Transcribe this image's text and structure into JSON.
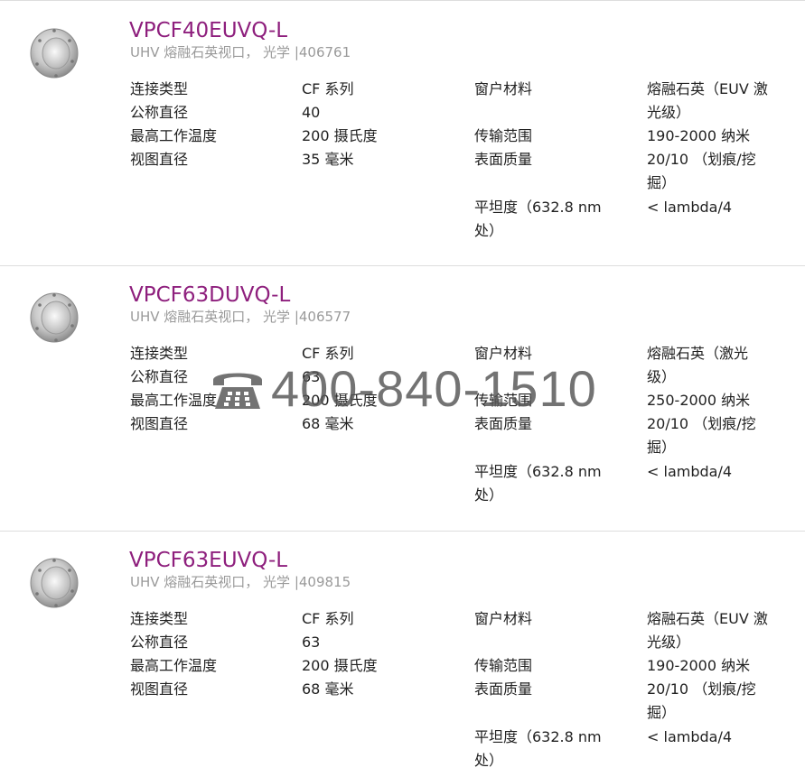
{
  "products": [
    {
      "title": "VPCF40EUVQ-L",
      "subtitle": "UHV 熔融石英视口， 光学 |406761",
      "specs": {
        "connection_type_label": "连接类型",
        "connection_type_value": "CF 系列",
        "nominal_diameter_label": "公称直径",
        "nominal_diameter_value": "40",
        "max_temp_label": "最高工作温度",
        "max_temp_value": "200 摄氏度",
        "view_diameter_label": "视图直径",
        "view_diameter_value": "35 毫米",
        "window_material_label": "窗户材料",
        "window_material_value_1": "熔融石英（EUV 激",
        "window_material_value_2": "光级）",
        "transmission_range_label": "传输范围",
        "transmission_range_value": "190-2000 纳米",
        "surface_quality_label": "表面质量",
        "surface_quality_value_1": "20/10 （划痕/挖",
        "surface_quality_value_2": "掘）",
        "flatness_label_1": "平坦度（632.8 nm",
        "flatness_label_2": "处）",
        "flatness_value": "< lambda/4"
      }
    },
    {
      "title": "VPCF63DUVQ-L",
      "subtitle": "UHV 熔融石英视口， 光学 |406577",
      "specs": {
        "connection_type_label": "连接类型",
        "connection_type_value": "CF 系列",
        "nominal_diameter_label": "公称直径",
        "nominal_diameter_value": "63",
        "max_temp_label": "最高工作温度",
        "max_temp_value": "200 摄氏度",
        "view_diameter_label": "视图直径",
        "view_diameter_value": "68 毫米",
        "window_material_label": "窗户材料",
        "window_material_value_1": "熔融石英（激光",
        "window_material_value_2": "级）",
        "transmission_range_label": "传输范围",
        "transmission_range_value": "250-2000 纳米",
        "surface_quality_label": "表面质量",
        "surface_quality_value_1": "20/10 （划痕/挖",
        "surface_quality_value_2": "掘）",
        "flatness_label_1": "平坦度（632.8 nm",
        "flatness_label_2": "处）",
        "flatness_value": "< lambda/4"
      }
    },
    {
      "title": "VPCF63EUVQ-L",
      "subtitle": "UHV 熔融石英视口， 光学 |409815",
      "specs": {
        "connection_type_label": "连接类型",
        "connection_type_value": "CF 系列",
        "nominal_diameter_label": "公称直径",
        "nominal_diameter_value": "63",
        "max_temp_label": "最高工作温度",
        "max_temp_value": "200 摄氏度",
        "view_diameter_label": "视图直径",
        "view_diameter_value": "68 毫米",
        "window_material_label": "窗户材料",
        "window_material_value_1": "熔融石英（EUV 激",
        "window_material_value_2": "光级）",
        "transmission_range_label": "传输范围",
        "transmission_range_value": "190-2000 纳米",
        "surface_quality_label": "表面质量",
        "surface_quality_value_1": "20/10 （划痕/挖",
        "surface_quality_value_2": "掘）",
        "flatness_label_1": "平坦度（632.8 nm",
        "flatness_label_2": "处）",
        "flatness_value": "< lambda/4"
      }
    }
  ],
  "watermark": {
    "phone": "400-840-1510",
    "icon": "telephone-icon"
  },
  "colors": {
    "title": "#8e1f7d",
    "subtitle": "#9a9a9a",
    "text": "#222222",
    "separator": "#dddddd"
  }
}
